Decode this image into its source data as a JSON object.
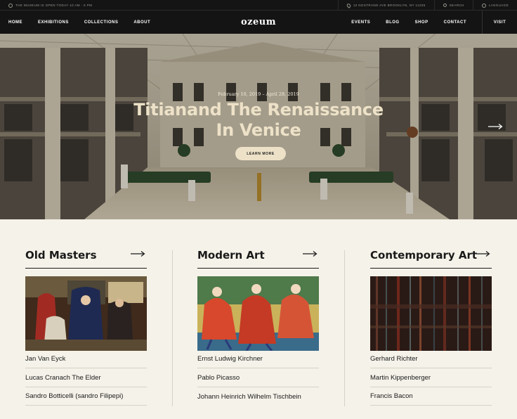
{
  "topbar": {
    "hours": "The Museum Is Open Today 10 AM - 5 PM",
    "address": "12 Nostrand Ave Brooklyn, NY 11205",
    "search": "Search",
    "language": "Language"
  },
  "nav": {
    "left": [
      "Home",
      "Exhibitions",
      "Collections",
      "About"
    ],
    "logo": "ozeum",
    "right": [
      "Events",
      "Blog",
      "Shop",
      "Contact"
    ],
    "visit": "Visit"
  },
  "hero": {
    "date": "February 10, 2019 – April 28, 2019",
    "title_line1": "Titianand The Renaissance",
    "title_line2": "In Venice",
    "cta": "Learn More",
    "next_icon": "arrow-right-icon"
  },
  "collections": [
    {
      "title": "Old Masters",
      "artists": [
        "Jan Van Eyck",
        "Lucas Cranach The Elder",
        "Sandro Botticelli (sandro Filipepi)"
      ]
    },
    {
      "title": "Modern Art",
      "artists": [
        "Ernst Ludwig Kirchner",
        "Pablo Picasso",
        "Johann Heinrich Wilhelm Tischbein"
      ]
    },
    {
      "title": "Contemporary Art",
      "artists": [
        "Gerhard Richter",
        "Martin Kippenberger",
        "Francis Bacon"
      ]
    }
  ],
  "colors": {
    "dark": "#141414",
    "cream": "#f5f2e9",
    "accent": "#ede2c8",
    "divider": "#d6d2c6"
  }
}
